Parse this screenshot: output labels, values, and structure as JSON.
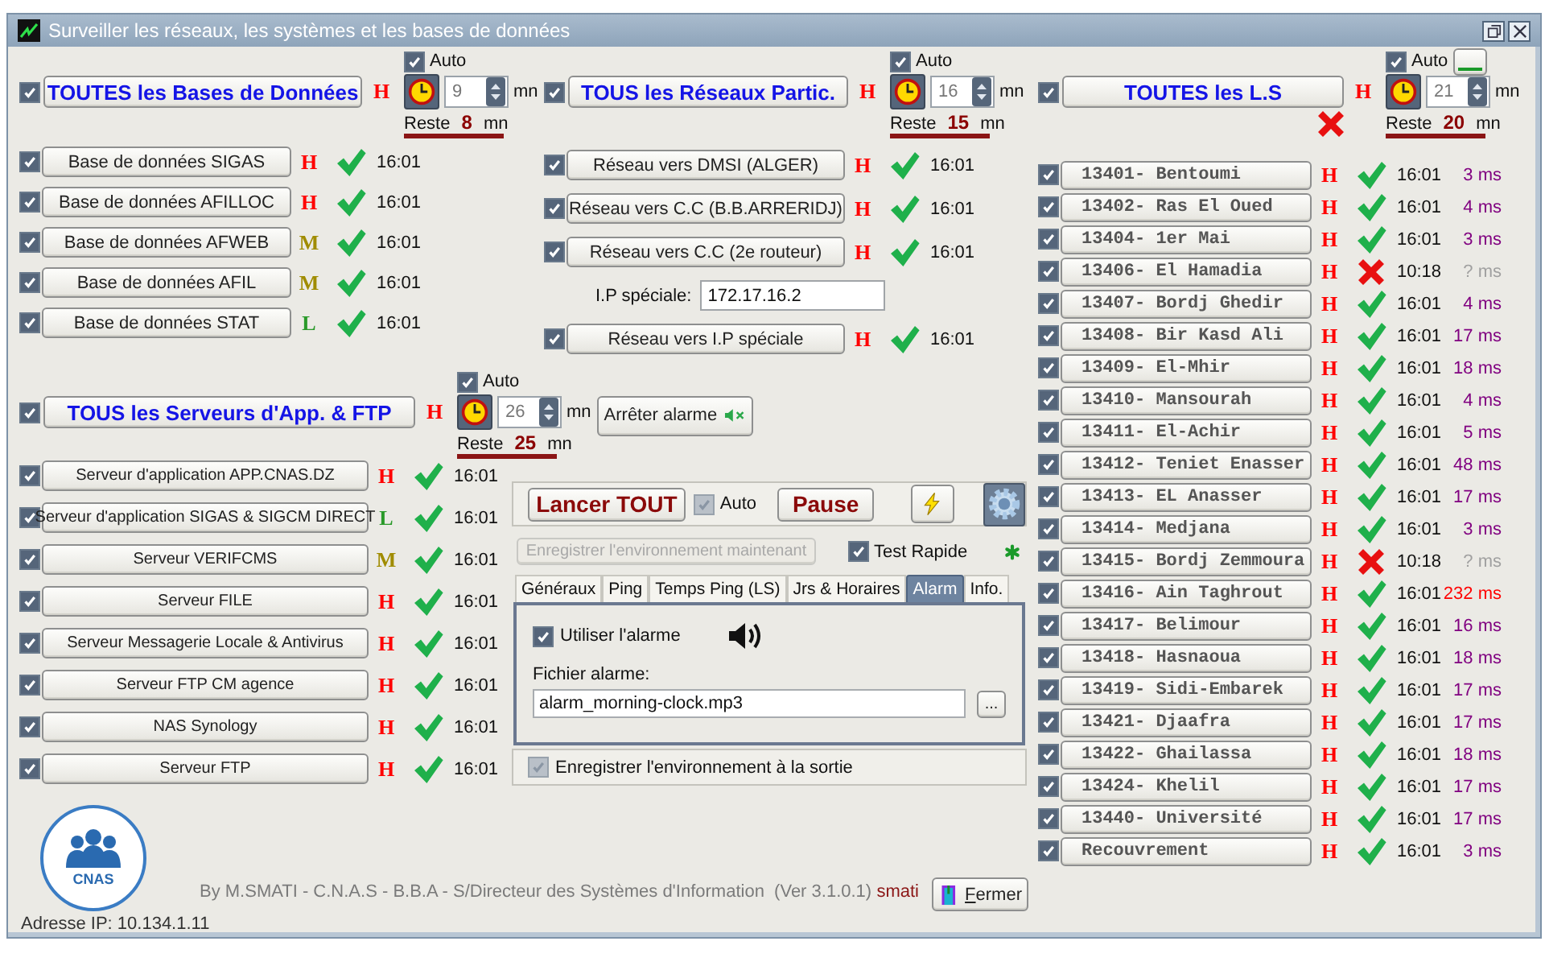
{
  "window": {
    "title": "Surveiller les réseaux, les systèmes et les bases de données"
  },
  "groups": [
    {
      "kind": "db",
      "enabled": true,
      "title": "TOUTES les Bases de Données",
      "priority": {
        "letter": "H",
        "color": "#ff0000"
      },
      "auto": true,
      "auto_label": "Auto",
      "interval": "9",
      "unit": "mn",
      "remaining_label": "Reste",
      "remaining": "8",
      "remaining_unit": "mn",
      "rows": [
        {
          "enabled": true,
          "label": "Base de données SIGAS",
          "priority": {
            "letter": "H",
            "color": "#ff0000"
          },
          "ok": true,
          "time": "16:01"
        },
        {
          "enabled": true,
          "label": "Base de données AFILLOC",
          "priority": {
            "letter": "H",
            "color": "#ff0000"
          },
          "ok": true,
          "time": "16:01"
        },
        {
          "enabled": true,
          "label": "Base de données AFWEB",
          "priority": {
            "letter": "M",
            "color": "#a08c00"
          },
          "ok": true,
          "time": "16:01"
        },
        {
          "enabled": true,
          "label": "Base de données AFIL",
          "priority": {
            "letter": "M",
            "color": "#a08c00"
          },
          "ok": true,
          "time": "16:01"
        },
        {
          "enabled": true,
          "label": "Base de données STAT",
          "priority": {
            "letter": "L",
            "color": "#2a9a2a"
          },
          "ok": true,
          "time": "16:01"
        }
      ]
    },
    {
      "kind": "net",
      "enabled": true,
      "title": "TOUS les Réseaux Partic.",
      "priority": {
        "letter": "H",
        "color": "#ff0000"
      },
      "auto": true,
      "auto_label": "Auto",
      "interval": "16",
      "unit": "mn",
      "remaining_label": "Reste",
      "remaining": "15",
      "remaining_unit": "mn",
      "rows": [
        {
          "kind": "target",
          "enabled": true,
          "label": "Réseau vers DMSI (ALGER)",
          "priority": {
            "letter": "H",
            "color": "#ff0000"
          },
          "ok": true,
          "time": "16:01"
        },
        {
          "kind": "target",
          "enabled": true,
          "label": "Réseau vers C.C (B.B.ARRERIDJ)",
          "priority": {
            "letter": "H",
            "color": "#ff0000"
          },
          "ok": true,
          "time": "16:01"
        },
        {
          "kind": "target",
          "enabled": true,
          "label": "Réseau vers C.C (2e routeur)",
          "priority": {
            "letter": "H",
            "color": "#ff0000"
          },
          "ok": true,
          "time": "16:01"
        },
        {
          "kind": "field",
          "label": "I.P spéciale:",
          "value": "172.17.16.2"
        },
        {
          "kind": "target",
          "enabled": true,
          "label": "Réseau vers I.P spéciale",
          "priority": {
            "letter": "H",
            "color": "#ff0000"
          },
          "ok": true,
          "time": "16:01"
        }
      ]
    },
    {
      "kind": "ls",
      "enabled": true,
      "title": "TOUTES les L.S",
      "priority": {
        "letter": "H",
        "color": "#ff0000"
      },
      "auto": true,
      "auto_label": "Auto",
      "interval": "21",
      "unit": "mn",
      "remaining_label": "Reste",
      "remaining": "20",
      "remaining_unit": "mn",
      "ok": false,
      "rows": [
        {
          "enabled": true,
          "label": "13401- Bentoumi",
          "priority": {
            "letter": "H",
            "color": "#ff0000"
          },
          "ok": true,
          "time": "16:01",
          "latency": {
            "text": "3 ms",
            "color": "#800080"
          }
        },
        {
          "enabled": true,
          "label": "13402- Ras El Oued",
          "priority": {
            "letter": "H",
            "color": "#ff0000"
          },
          "ok": true,
          "time": "16:01",
          "latency": {
            "text": "4 ms",
            "color": "#800080"
          }
        },
        {
          "enabled": true,
          "label": "13404- 1er Mai",
          "priority": {
            "letter": "H",
            "color": "#ff0000"
          },
          "ok": true,
          "time": "16:01",
          "latency": {
            "text": "3 ms",
            "color": "#800080"
          }
        },
        {
          "enabled": true,
          "label": "13406- El Hamadia",
          "priority": {
            "letter": "H",
            "color": "#ff0000"
          },
          "ok": false,
          "time": "10:18",
          "latency": {
            "text": "? ms",
            "color": "#a0a0a0"
          }
        },
        {
          "enabled": true,
          "label": "13407- Bordj Ghedir",
          "priority": {
            "letter": "H",
            "color": "#ff0000"
          },
          "ok": true,
          "time": "16:01",
          "latency": {
            "text": "4 ms",
            "color": "#800080"
          }
        },
        {
          "enabled": true,
          "label": "13408- Bir Kasd Ali",
          "priority": {
            "letter": "H",
            "color": "#ff0000"
          },
          "ok": true,
          "time": "16:01",
          "latency": {
            "text": "17 ms",
            "color": "#800080"
          }
        },
        {
          "enabled": true,
          "label": "13409- El-Mhir",
          "priority": {
            "letter": "H",
            "color": "#ff0000"
          },
          "ok": true,
          "time": "16:01",
          "latency": {
            "text": "18 ms",
            "color": "#800080"
          }
        },
        {
          "enabled": true,
          "label": "13410- Mansourah",
          "priority": {
            "letter": "H",
            "color": "#ff0000"
          },
          "ok": true,
          "time": "16:01",
          "latency": {
            "text": "4 ms",
            "color": "#800080"
          }
        },
        {
          "enabled": true,
          "label": "13411- El-Achir",
          "priority": {
            "letter": "H",
            "color": "#ff0000"
          },
          "ok": true,
          "time": "16:01",
          "latency": {
            "text": "5 ms",
            "color": "#800080"
          }
        },
        {
          "enabled": true,
          "label": "13412- Teniet Enasser",
          "priority": {
            "letter": "H",
            "color": "#ff0000"
          },
          "ok": true,
          "time": "16:01",
          "latency": {
            "text": "48 ms",
            "color": "#800080"
          }
        },
        {
          "enabled": true,
          "label": "13413- EL Anasser",
          "priority": {
            "letter": "H",
            "color": "#ff0000"
          },
          "ok": true,
          "time": "16:01",
          "latency": {
            "text": "17 ms",
            "color": "#800080"
          }
        },
        {
          "enabled": true,
          "label": "13414- Medjana",
          "priority": {
            "letter": "H",
            "color": "#ff0000"
          },
          "ok": true,
          "time": "16:01",
          "latency": {
            "text": "3 ms",
            "color": "#800080"
          }
        },
        {
          "enabled": true,
          "label": "13415- Bordj Zemmoura",
          "priority": {
            "letter": "H",
            "color": "#ff0000"
          },
          "ok": false,
          "time": "10:18",
          "latency": {
            "text": "? ms",
            "color": "#a0a0a0"
          }
        },
        {
          "enabled": true,
          "label": "13416- Ain Taghrout",
          "priority": {
            "letter": "H",
            "color": "#ff0000"
          },
          "ok": true,
          "time": "16:01",
          "latency": {
            "text": "232 ms",
            "color": "#ff0000"
          }
        },
        {
          "enabled": true,
          "label": "13417- Belimour",
          "priority": {
            "letter": "H",
            "color": "#ff0000"
          },
          "ok": true,
          "time": "16:01",
          "latency": {
            "text": "16 ms",
            "color": "#800080"
          }
        },
        {
          "enabled": true,
          "label": "13418- Hasnaoua",
          "priority": {
            "letter": "H",
            "color": "#ff0000"
          },
          "ok": true,
          "time": "16:01",
          "latency": {
            "text": "18 ms",
            "color": "#800080"
          }
        },
        {
          "enabled": true,
          "label": "13419- Sidi-Embarek",
          "priority": {
            "letter": "H",
            "color": "#ff0000"
          },
          "ok": true,
          "time": "16:01",
          "latency": {
            "text": "17 ms",
            "color": "#800080"
          }
        },
        {
          "enabled": true,
          "label": "13421- Djaafra",
          "priority": {
            "letter": "H",
            "color": "#ff0000"
          },
          "ok": true,
          "time": "16:01",
          "latency": {
            "text": "17 ms",
            "color": "#800080"
          }
        },
        {
          "enabled": true,
          "label": "13422- Ghailassa",
          "priority": {
            "letter": "H",
            "color": "#ff0000"
          },
          "ok": true,
          "time": "16:01",
          "latency": {
            "text": "18 ms",
            "color": "#800080"
          }
        },
        {
          "enabled": true,
          "label": "13424- Khelil",
          "priority": {
            "letter": "H",
            "color": "#ff0000"
          },
          "ok": true,
          "time": "16:01",
          "latency": {
            "text": "17 ms",
            "color": "#800080"
          }
        },
        {
          "enabled": true,
          "label": "13440- Université",
          "priority": {
            "letter": "H",
            "color": "#ff0000"
          },
          "ok": true,
          "time": "16:01",
          "latency": {
            "text": "17 ms",
            "color": "#800080"
          }
        },
        {
          "enabled": true,
          "label": "Recouvrement",
          "priority": {
            "letter": "H",
            "color": "#ff0000"
          },
          "ok": true,
          "time": "16:01",
          "latency": {
            "text": "3 ms",
            "color": "#800080"
          }
        }
      ]
    },
    {
      "kind": "server",
      "enabled": true,
      "title": "TOUS les Serveurs d'App. & FTP",
      "priority": {
        "letter": "H",
        "color": "#ff0000"
      },
      "auto": true,
      "auto_label": "Auto",
      "interval": "26",
      "unit": "mn",
      "remaining_label": "Reste",
      "remaining": "25",
      "remaining_unit": "mn",
      "rows": [
        {
          "enabled": true,
          "label": "Serveur d'application APP.CNAS.DZ",
          "priority": {
            "letter": "H",
            "color": "#ff0000"
          },
          "ok": true,
          "time": "16:01"
        },
        {
          "enabled": true,
          "label": "Serveur d'application SIGAS & SIGCM DIRECT",
          "priority": {
            "letter": "L",
            "color": "#2a9a2a"
          },
          "ok": true,
          "time": "16:01"
        },
        {
          "enabled": true,
          "label": "Serveur VERIFCMS",
          "priority": {
            "letter": "M",
            "color": "#a08c00"
          },
          "ok": true,
          "time": "16:01"
        },
        {
          "enabled": true,
          "label": "Serveur FILE",
          "priority": {
            "letter": "H",
            "color": "#ff0000"
          },
          "ok": true,
          "time": "16:01"
        },
        {
          "enabled": true,
          "label": "Serveur Messagerie Locale & Antivirus",
          "priority": {
            "letter": "H",
            "color": "#ff0000"
          },
          "ok": true,
          "time": "16:01"
        },
        {
          "enabled": true,
          "label": "Serveur FTP CM agence",
          "priority": {
            "letter": "H",
            "color": "#ff0000"
          },
          "ok": true,
          "time": "16:01"
        },
        {
          "enabled": true,
          "label": "NAS Synology",
          "priority": {
            "letter": "H",
            "color": "#ff0000"
          },
          "ok": true,
          "time": "16:01"
        },
        {
          "enabled": true,
          "label": "Serveur FTP",
          "priority": {
            "letter": "H",
            "color": "#ff0000"
          },
          "ok": true,
          "time": "16:01"
        }
      ]
    }
  ],
  "stop_alarm": {
    "label": "Arrêter alarme"
  },
  "controls": {
    "launch": "Lancer TOUT",
    "auto": {
      "label": "Auto",
      "checked": true,
      "disabled": true
    },
    "pause": "Pause",
    "save_now": {
      "label": "Enregistrer l'environnement maintenant",
      "disabled": true
    },
    "fast_test": {
      "label": "Test Rapide",
      "checked": true
    }
  },
  "tabs": [
    {
      "label": "Généraux",
      "selected": false
    },
    {
      "label": "Ping",
      "selected": false
    },
    {
      "label": "Temps Ping (LS)",
      "selected": false
    },
    {
      "label": "Jrs & Horaires",
      "selected": false
    },
    {
      "label": "Alarm",
      "selected": true
    },
    {
      "label": "Info.",
      "selected": false
    }
  ],
  "alarm_tab": {
    "use_alarm": {
      "label": "Utiliser l'alarme",
      "checked": true
    },
    "file_label": "Fichier alarme:",
    "file": "alarm_morning-clock.mp3",
    "browse": "..."
  },
  "save_on_exit": {
    "label": "Enregistrer l'environnement à la sortie",
    "checked": true,
    "disabled": true
  },
  "footer": {
    "logo_text": "CNAS",
    "credits": "By M.SMATI - C.N.A.S - B.B.A - S/Directeur des Systèmes d'Information  (Ver 3.1.0.1)",
    "user": "smati",
    "close": "Fermer"
  },
  "status_bar": {
    "ip": "Adresse IP: 10.134.1.11"
  }
}
